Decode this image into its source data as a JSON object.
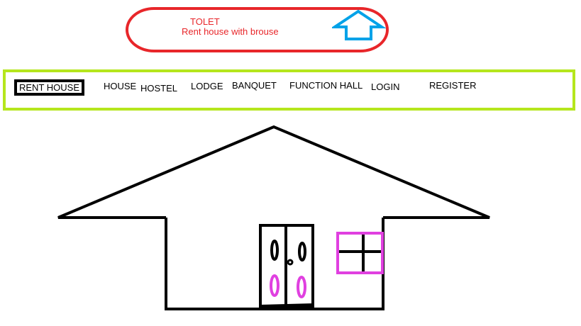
{
  "header": {
    "title": "TOLET",
    "subtitle": "Rent house with brouse",
    "accent_color": "#e8262a",
    "arrow_icon": "up-arrow-icon",
    "arrow_color": "#00a2e8"
  },
  "nav": {
    "border_color": "#b5e61d",
    "items": [
      {
        "label": "RENT HOUSE"
      },
      {
        "label": "HOUSE"
      },
      {
        "label": "HOSTEL"
      },
      {
        "label": "LODGE"
      },
      {
        "label": "BANQUET"
      },
      {
        "label": "FUNCTION HALL"
      },
      {
        "label": "LOGIN"
      },
      {
        "label": "REGISTER"
      }
    ]
  },
  "illustration": {
    "subject": "house-icon",
    "stroke_color": "#000000",
    "window_color": "#e040e0"
  }
}
